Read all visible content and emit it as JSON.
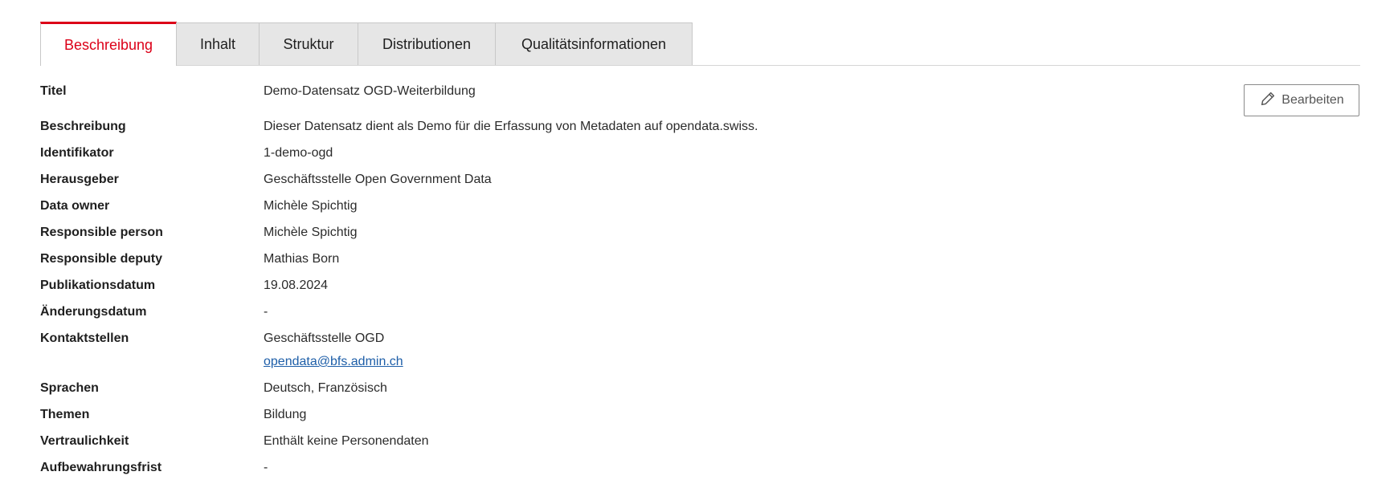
{
  "tabs": [
    {
      "label": "Beschreibung",
      "active": true
    },
    {
      "label": "Inhalt",
      "active": false
    },
    {
      "label": "Struktur",
      "active": false
    },
    {
      "label": "Distributionen",
      "active": false
    },
    {
      "label": "Qualitätsinformationen",
      "active": false
    }
  ],
  "edit_button": {
    "label": "Bearbeiten",
    "icon": "pencil-icon"
  },
  "colors": {
    "accent": "#dc0018",
    "link": "#1d5ea8",
    "tab_inactive": "#e6e6e6"
  },
  "details": {
    "titel": {
      "label": "Titel",
      "value": "Demo-Datensatz OGD-Weiterbildung"
    },
    "beschreibung": {
      "label": "Beschreibung",
      "value": "Dieser Datensatz dient als Demo für die Erfassung von Metadaten auf opendata.swiss."
    },
    "identifikator": {
      "label": "Identifikator",
      "value": "1-demo-ogd"
    },
    "herausgeber": {
      "label": "Herausgeber",
      "value": "Geschäftsstelle Open Government Data"
    },
    "data_owner": {
      "label": "Data owner",
      "value": "Michèle Spichtig"
    },
    "responsible_person": {
      "label": "Responsible person",
      "value": "Michèle Spichtig"
    },
    "responsible_deputy": {
      "label": "Responsible deputy",
      "value": "Mathias Born"
    },
    "publikationsdatum": {
      "label": "Publikationsdatum",
      "value": "19.08.2024"
    },
    "aenderungsdatum": {
      "label": "Änderungsdatum",
      "value": "-"
    },
    "kontaktstellen": {
      "label": "Kontaktstellen",
      "name": "Geschäftsstelle OGD",
      "email": "opendata@bfs.admin.ch"
    },
    "sprachen": {
      "label": "Sprachen",
      "value": "Deutsch, Französisch"
    },
    "themen": {
      "label": "Themen",
      "value": "Bildung"
    },
    "vertraulichkeit": {
      "label": "Vertraulichkeit",
      "value": "Enthält keine Personendaten"
    },
    "aufbewahrungsfrist": {
      "label": "Aufbewahrungsfrist",
      "value": "-"
    }
  }
}
